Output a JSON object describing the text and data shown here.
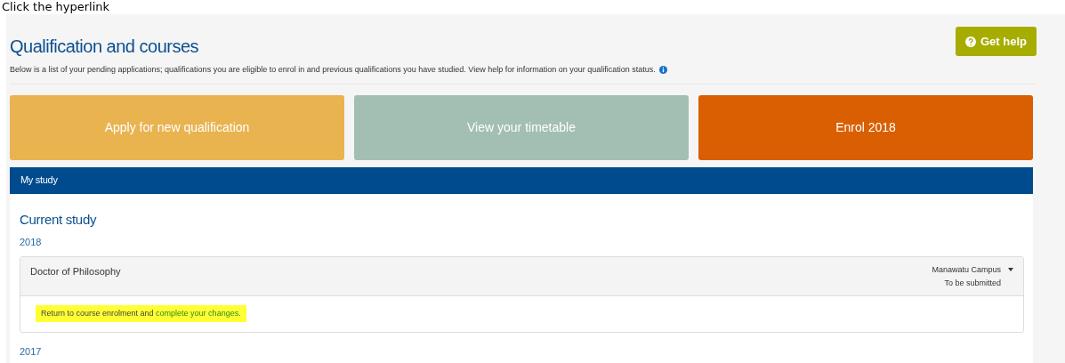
{
  "annotation": "Click the hyperlink",
  "page": {
    "title": "Qualification and courses",
    "description": "Below is a list of your pending applications; qualifications you are eligible to enrol in and previous qualifications you have studied. View help for information on your qualification status.",
    "help_button": "Get help"
  },
  "tiles": [
    {
      "label": "Apply for new qualification",
      "color": "#e9b350"
    },
    {
      "label": "View your timetable",
      "color": "#a3bfb3"
    },
    {
      "label": "Enrol 2018",
      "color": "#d95f02"
    }
  ],
  "panel": {
    "title": "My study",
    "section": "Current study",
    "years": [
      {
        "year": "2018",
        "qualifications": [
          {
            "name": "Doctor of Philosophy",
            "campus": "Manawatu Campus",
            "status": "To be submitted",
            "message": "Return to course enrolment and",
            "link": "complete your changes.",
            "highlighted": true
          }
        ]
      },
      {
        "year": "2017"
      }
    ]
  }
}
